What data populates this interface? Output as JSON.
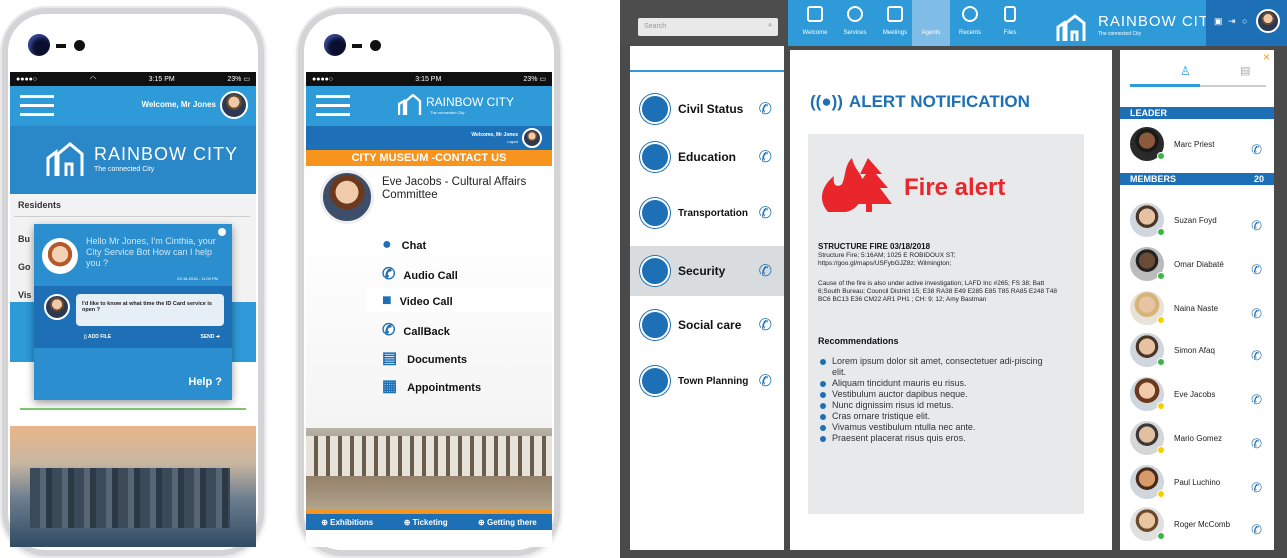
{
  "colors": {
    "blue": "#2e9ad8",
    "dark_blue": "#1e70b6",
    "orange": "#f7941d",
    "red": "#e8262b",
    "online": "#39b54a",
    "away": "#f5d000"
  },
  "phone1": {
    "status": {
      "carrier": "●●●●○",
      "wifi": "wifi-icon",
      "time": "3:15 PM",
      "battery": "23%"
    },
    "header": {
      "welcome": "Welcome, Mr Jones"
    },
    "brand": {
      "name": "RAINBOW CITY",
      "tagline": "The connected City"
    },
    "menu": [
      {
        "label": "Residents"
      },
      {
        "label": "Bu"
      },
      {
        "label": "Go"
      },
      {
        "label": "Vis"
      }
    ],
    "chat": {
      "bot_message": "Hello Mr Jones, I'm Cinthia, your City Service Bot How can I help you ?",
      "timestamp": "03-18-2018 - 11:00 PM",
      "user_message": "I'd like to know at what time the ID Card service is open ?",
      "add_file": "ADD FILE",
      "send": "SEND",
      "help": "Help ?"
    }
  },
  "phone2": {
    "status": {
      "carrier": "●●●●○",
      "time": "3:15 PM",
      "battery": "23%"
    },
    "brand": {
      "name": "RAINBOW CITY",
      "tagline": "The connected City"
    },
    "header": {
      "welcome": "Welcome, Mr Jones",
      "logout": "Logout"
    },
    "banner": "CITY MUSEUM -CONTACT US",
    "contact": {
      "name": "Eve Jacobs  - Cultural Affairs Committee"
    },
    "actions": [
      {
        "label": "Chat",
        "icon": "chat-bubble-icon"
      },
      {
        "label": "Audio Call",
        "icon": "audio-call-icon"
      },
      {
        "label": "Video Call",
        "icon": "video-camera-icon"
      },
      {
        "label": "CallBack",
        "icon": "callback-icon"
      },
      {
        "label": "Documents",
        "icon": "documents-icon"
      },
      {
        "label": "Appointments",
        "icon": "calendar-icon"
      }
    ],
    "footer": [
      {
        "label": "Exhibitions"
      },
      {
        "label": "Ticketing"
      },
      {
        "label": "Getting there"
      }
    ]
  },
  "desktop": {
    "search": {
      "placeholder": "Search"
    },
    "nav": [
      {
        "label": "Welcome"
      },
      {
        "label": "Services"
      },
      {
        "label": "Meetings"
      },
      {
        "label": "Agents"
      },
      {
        "label": "Recents"
      },
      {
        "label": "Files"
      }
    ],
    "brand": {
      "name": "RAINBOW CITY",
      "tagline": "The connected City"
    },
    "categories": [
      {
        "label": "Civil Status"
      },
      {
        "label": "Education"
      },
      {
        "label": "Transportation"
      },
      {
        "label": "Security"
      },
      {
        "label": "Social care"
      },
      {
        "label": "Town Planning"
      }
    ],
    "alert": {
      "title": "ALERT NOTIFICATION",
      "fire_title": "Fire alert",
      "structure": "STRUCTURE FIRE 03/18/2018",
      "details": "Structure Fire; 5:16AM; 1025 E ROBIDOUX ST; https://goo.gl/maps/USFybGJZ8z; Wilmington;",
      "cause": "Cause of the fire is also under active investigation; LAFD Inc #265; FS 38; Batt 6;South Bureau; Council District 15; E38 RA38 E49 E285 E85 T85 RA85 E248 T48 BC6 BC13 E36 CM22 AR1 PH1 ; CH: 9; 12; Amy Bastman",
      "rec_title": "Recommendations",
      "recommendations": [
        "Lorem ipsum dolor sit amet, consectetuer adi-piscing elit.",
        "Aliquam tincidunt mauris eu risus.",
        "Vestibulum auctor dapibus neque.",
        "Nunc dignissim risus id metus.",
        "Cras ornare tristique elit.",
        "Vivamus vestibulum ntulla nec ante.",
        "Praesent placerat risus quis eros."
      ]
    },
    "team": {
      "leader_label": "LEADER",
      "leader": "Marc Priest",
      "members_label": "MEMBERS",
      "members_count": "20",
      "members": [
        {
          "name": "Suzan Foyd",
          "status": "online"
        },
        {
          "name": "Omar Diabaté",
          "status": "online"
        },
        {
          "name": "Naina Naste",
          "status": "away"
        },
        {
          "name": "Simon Afaq",
          "status": "online"
        },
        {
          "name": "Eve Jacobs",
          "status": "away"
        },
        {
          "name": "Mario Gomez",
          "status": "away"
        },
        {
          "name": "Paul Luchino",
          "status": "away"
        },
        {
          "name": "Roger  McComb",
          "status": "online"
        }
      ]
    }
  }
}
